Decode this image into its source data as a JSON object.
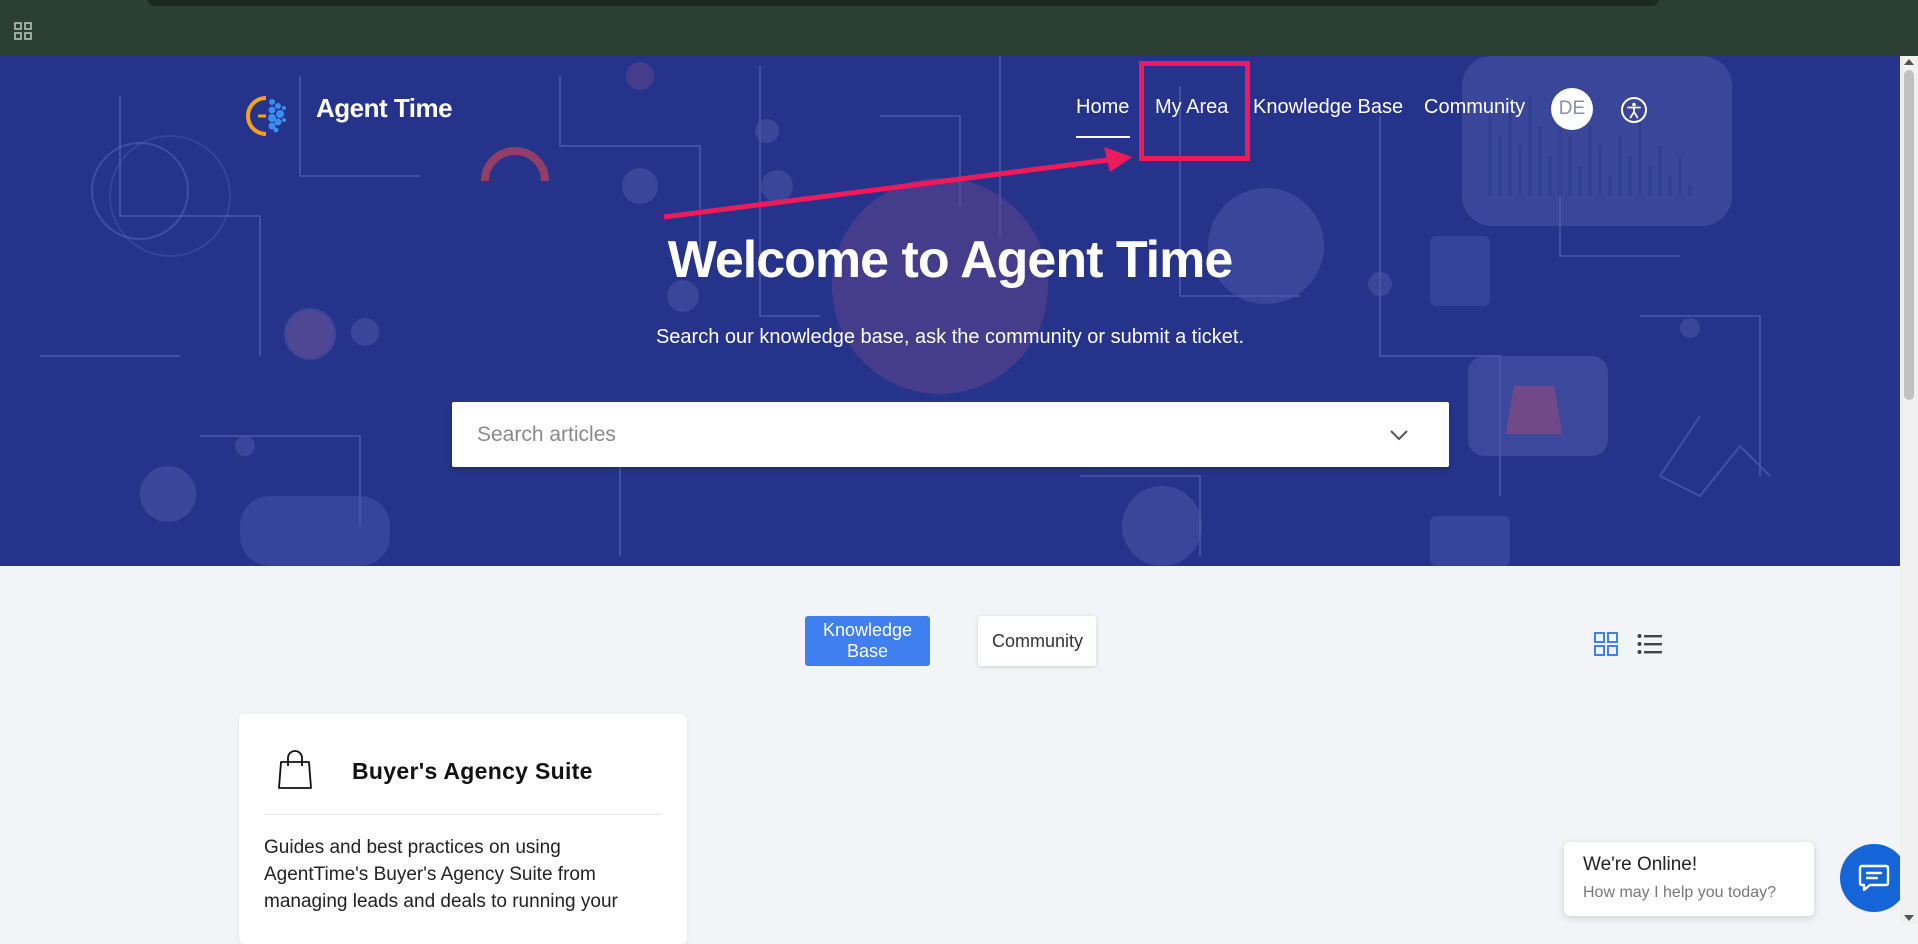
{
  "browser": {
    "apps_icon": "grid-apps-icon"
  },
  "header": {
    "brand": "Agent Time",
    "nav": [
      {
        "label": "Home",
        "active": true
      },
      {
        "label": "My Area"
      },
      {
        "label": "Knowledge Base"
      },
      {
        "label": "Community"
      }
    ],
    "avatar_initials": "DE",
    "accessibility_icon": "accessibility-icon"
  },
  "hero": {
    "title": "Welcome to Agent Time",
    "subtitle": "Search our knowledge base, ask the community or submit a ticket.",
    "search": {
      "placeholder": "Search articles",
      "value": ""
    }
  },
  "tabs": {
    "knowledge_base": "Knowledge Base",
    "community": "Community",
    "active": "knowledge_base"
  },
  "cards": [
    {
      "title": "Buyer's Agency Suite",
      "description": "Guides and best practices on using AgentTime's Buyer's Agency Suite from managing leads and deals to running your",
      "icon": "shopping-bag-icon"
    }
  ],
  "chat": {
    "title": "We're Online!",
    "subtitle": "How may I help you today?"
  },
  "colors": {
    "hero_bg": "#26338a",
    "primary_button": "#3f7ff0",
    "chat_button": "#1565d8",
    "annotation": "#ee1a5b",
    "top_bar": "#2b3f33"
  }
}
